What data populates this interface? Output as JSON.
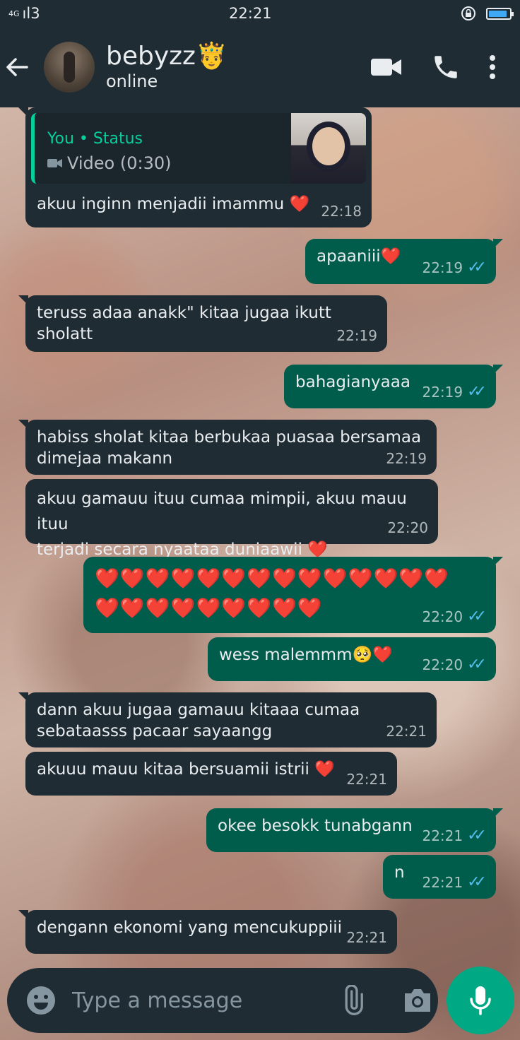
{
  "status_bar": {
    "network": "4G",
    "signal": "ıl3",
    "time": "22:21",
    "battery_level": 0.9
  },
  "header": {
    "contact_name": "bebyzz🤴",
    "contact_status": "online"
  },
  "colors": {
    "header_bg": "#1f2c34",
    "incoming_bubble": "#1f2c34",
    "outgoing_bubble": "#005c4b",
    "accent": "#00a884",
    "read_ticks": "#53bdeb"
  },
  "messages": [
    {
      "dir": "in",
      "quote_author": "You • Status",
      "quote_body": "Video (0:30)",
      "text": "akuu inginn menjadii imammu ❤️",
      "time": "22:18"
    },
    {
      "dir": "out",
      "text": "apaaniii❤️",
      "time": "22:19",
      "ticks": "✓✓"
    },
    {
      "dir": "in",
      "text": "teruss adaa anakk\" kitaa jugaa ikutt sholatt",
      "time": "22:19"
    },
    {
      "dir": "out",
      "text": "bahagianyaaa",
      "time": "22:19",
      "ticks": "✓✓"
    },
    {
      "dir": "in",
      "text": "habiss sholat kitaa berbukaa puasaa bersamaa\ndimejaa makann",
      "time": "22:19"
    },
    {
      "dir": "in",
      "text": "akuu gamauu ituu cumaa mimpii, akuu mauu ituu\nterjadi secara nyaataa duniaawii ❤️",
      "time": "22:20"
    },
    {
      "dir": "out",
      "text": "❤️❤️❤️❤️❤️❤️❤️❤️❤️❤️❤️❤️❤️❤️\n❤️❤️❤️❤️❤️❤️❤️❤️❤️",
      "time": "22:20",
      "ticks": "✓✓"
    },
    {
      "dir": "out",
      "text": "wess malemmm🥺❤️",
      "time": "22:20",
      "ticks": "✓✓"
    },
    {
      "dir": "in",
      "text": "dann akuu jugaa gamauu kitaaa cumaa\nsebataasss pacaar sayaangg",
      "time": "22:21"
    },
    {
      "dir": "in",
      "text": "akuuu mauu kitaa bersuamii istrii ❤️",
      "time": "22:21"
    },
    {
      "dir": "out",
      "text": "okee besokk tunabgann",
      "time": "22:21",
      "ticks": "✓✓"
    },
    {
      "dir": "out",
      "text": "n",
      "time": "22:21",
      "ticks": "✓✓"
    },
    {
      "dir": "in",
      "text": "dengann ekonomi yang mencukuppiii",
      "time": "22:21"
    }
  ],
  "composer": {
    "placeholder": "Type a message"
  }
}
